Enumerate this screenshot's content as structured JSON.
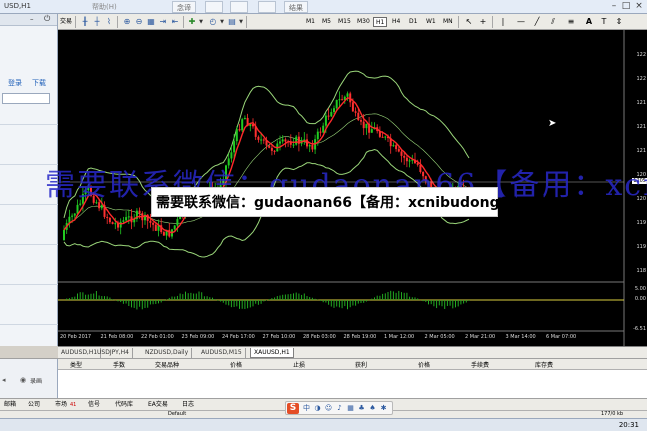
{
  "window": {
    "title": "USD,H1",
    "menu_items": [
      "帮助(H)"
    ],
    "pills": [
      "念谛",
      "结果"
    ],
    "controls": [
      "–",
      "□",
      "×"
    ]
  },
  "left_panel": {
    "links": [
      "登录",
      "下载"
    ]
  },
  "toolbar": {
    "label": "交易",
    "periods": [
      "M1",
      "M5",
      "M15",
      "M30",
      "H1",
      "H4",
      "D1",
      "W1",
      "MN"
    ],
    "active_period": "H1"
  },
  "chart": {
    "time_labels": [
      "20 Feb 2017",
      "21 Feb 08:00",
      "22 Feb 01:00",
      "23 Feb 09:00",
      "24 Feb 17:00",
      "27 Feb 10:00",
      "28 Feb 03:00",
      "28 Feb 19:00",
      "1 Mar 12:00",
      "2 Mar 05:00",
      "2 Mar 21:00",
      "3 Mar 14:00",
      "6 Mar 07:00"
    ],
    "highlight_price": "1205",
    "indicator_labels": [
      "5.00",
      "0.00",
      "-6.51"
    ],
    "bollinger_color": "#9ad67a",
    "ma_color": "#ff2a2a",
    "bull_color": "#22cc22",
    "bear_color": "#ff3030"
  },
  "chart_tabs": [
    {
      "label": "AUDUSD,H1"
    },
    {
      "label": "USDJPY,H4"
    },
    {
      "label": "NZDUSD,Daily"
    },
    {
      "label": "AUDUSD,M15"
    },
    {
      "label": "XAUUSD,H1",
      "active": true
    }
  ],
  "terminal": {
    "columns": [
      "类型",
      "手数",
      "交易品种",
      "价格",
      "止损",
      "获利",
      "价格",
      "手续费",
      "库存费"
    ]
  },
  "bottom_tabs": [
    "邮箱",
    "公司",
    "市场",
    "信号",
    "代码库",
    "EA交易",
    "日志"
  ],
  "market_badge": "41",
  "status": {
    "profile": "Default",
    "traffic": "177/0 kb"
  },
  "overlay": {
    "watermark": "需要联系微信：gudaonan66【备用：xcnibudong0105】",
    "banner": "需要联系微信：gudaonan66【备用：xcnibudong0105】"
  },
  "taskbar": {
    "clock": "20:31"
  },
  "left_tools": {
    "record_label": "录画"
  }
}
